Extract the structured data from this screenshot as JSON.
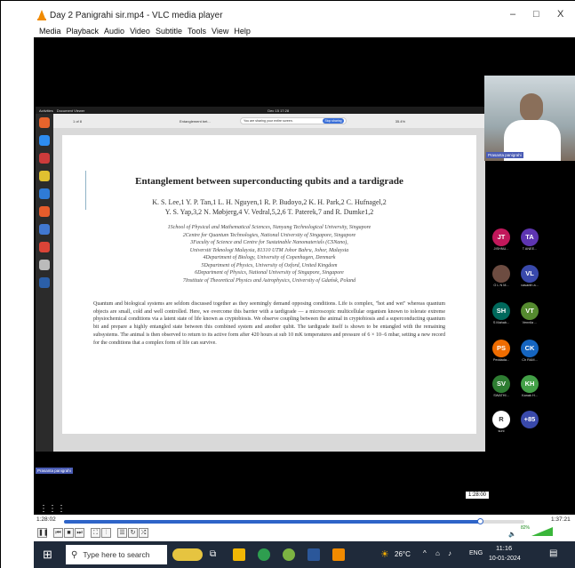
{
  "window": {
    "title": "Day 2 Panigrahi sir.mp4 - VLC media player",
    "min": "–",
    "max": "□",
    "close": "X"
  },
  "menu": [
    "Media",
    "Playback",
    "Audio",
    "Video",
    "Subtitle",
    "Tools",
    "View",
    "Help"
  ],
  "inner": {
    "activities": "Activities",
    "viewer_app": "Document Viewer",
    "clock": "Dec 15 17:28",
    "share_text": "You are sharing your entire screen.",
    "stop_sharing": "Stop sharing",
    "page_num": "1 of 8",
    "zoom": "35.4%",
    "doc_title_short": "Entanglement bet..."
  },
  "paper": {
    "title": "Entanglement between superconducting qubits and a tardigrade",
    "authors_line1": "K. S. Lee,1 Y. P. Tan,1 L. H. Nguyen,1 R. P. Budoyo,2 K. H. Park,2 C. Hufnagel,2",
    "authors_line2": "Y. S. Yap,3,2 N. Møbjerg,4 V. Vedral,5,2,6 T. Paterek,7 and R. Dumke1,2",
    "affil1": "1School of Physical and Mathematical Sciences, Nanyang Technological University, Singapore",
    "affil2": "2Centre for Quantum Technologies, National University of Singapore, Singapore",
    "affil3": "3Faculty of Science and Centre for Sustainable Nanomaterials (CSNano),",
    "affil4": "Universiti Teknologi Malaysia, 81310 UTM Johor Bahru, Johor, Malaysia",
    "affil5": "4Department of Biology, University of Copenhagen, Denmark",
    "affil6": "5Department of Physics, University of Oxford, United Kingdom",
    "affil7": "6Department of Physics, National University of Singapore, Singapore",
    "affil8": "7Institute of Theoretical Physics and Astrophysics, University of Gdańsk, Poland",
    "abstract": "Quantum and biological systems are seldom discussed together as they seemingly demand opposing conditions. Life is complex, \"hot and wet\" whereas quantum objects are small, cold and well controlled. Here, we overcome this barrier with a tardigrade — a microscopic multicellular organism known to tolerate extreme physiochemical conditions via a latent state of life known as cryptobiosis. We observe coupling between the animal in cryptobiosis and a superconducting quantum bit and prepare a highly entangled state between this combined system and another qubit. The tardigrade itself is shown to be entangled with the remaining subsystems. The animal is then observed to return to its active form after 420 hours at sub 10 mK temperatures and pressure of 6 × 10−6 mbar, setting a new record for the conditions that a complex form of life can survive."
  },
  "participants": {
    "presenter": "Prasanta panigrahi",
    "presenter_bottom": "Prasanta panigrahi",
    "avatars": [
      {
        "initials": "JT",
        "name": "JISHNU...",
        "color": "#c2185b"
      },
      {
        "initials": "TA",
        "name": "T ANEE...",
        "color": "#5e35b1"
      },
      {
        "initials": "",
        "name": "G L N M...",
        "color": "#6d4c41"
      },
      {
        "initials": "VL",
        "name": "vasanth a...",
        "color": "#3949ab"
      },
      {
        "initials": "SH",
        "name": "S Mahab...",
        "color": "#00695c"
      },
      {
        "initials": "VT",
        "name": "Vennila ...",
        "color": "#558b2f"
      },
      {
        "initials": "PS",
        "name": "Peddada...",
        "color": "#ef6c00"
      },
      {
        "initials": "CK",
        "name": "Ch RAM...",
        "color": "#1565c0"
      },
      {
        "initials": "SV",
        "name": "SWATHI...",
        "color": "#2e7d32"
      },
      {
        "initials": "KH",
        "name": "Kanak H...",
        "color": "#43a047"
      },
      {
        "initials": "R",
        "name": "suni",
        "color": "#ffffff"
      },
      {
        "initials": "+85",
        "name": "",
        "color": "#3949ab"
      }
    ]
  },
  "player": {
    "tooltip_time": "1:28:00",
    "elapsed": "1:28:02",
    "total": "1:37:21",
    "progress": 0.904,
    "volume": "82%"
  },
  "taskbar": {
    "search_placeholder": "Type here to search",
    "weather": "26°C",
    "lang": "ENG",
    "time": "11:16",
    "date": "10-01-2024"
  }
}
